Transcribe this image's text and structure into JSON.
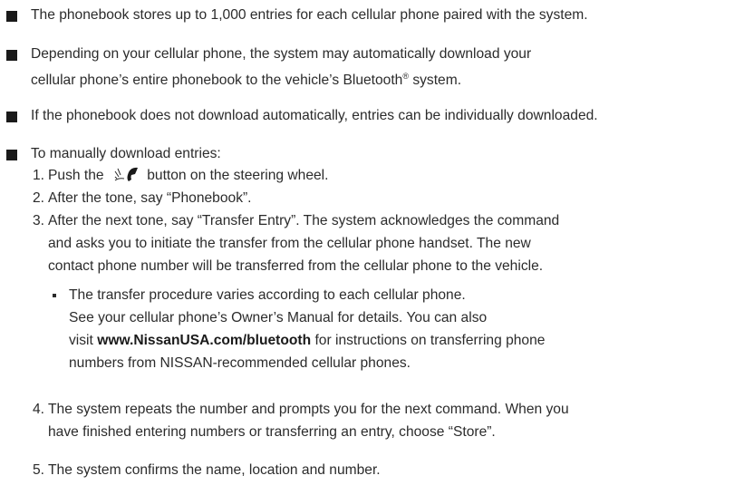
{
  "bullets": [
    {
      "lines": [
        "The phonebook stores up to 1,000 entries for each cellular phone paired with the system."
      ]
    },
    {
      "lines": [
        "Depending on your cellular phone, the system may automatically download your",
        "cellular phone’s entire phonebook to the vehicle’s Bluetooth"
      ],
      "line2_suffix": " system.",
      "trademark": "®"
    },
    {
      "lines": [
        "If the phonebook does not download automatically, entries can be individually downloaded."
      ]
    },
    {
      "lines": [
        "To manually download entries:"
      ]
    }
  ],
  "steps": [
    {
      "num": "1.",
      "before_icon": "Push the ",
      "icon": "voice-phone-icon",
      "after_icon": " button on the steering wheel."
    },
    {
      "num": "2.",
      "lines": [
        "After the tone, say “Phonebook”."
      ]
    },
    {
      "num": "3.",
      "lines": [
        "After the next tone, say “Transfer Entry”. The system acknowledges the command",
        "and asks you to initiate the transfer from the cellular phone handset. The new",
        "contact phone number will be transferred from the cellular phone to the vehicle."
      ]
    },
    {
      "num": "4.",
      "lines": [
        "The system repeats the number and prompts you for the next command. When you",
        "have finished entering numbers or transferring an entry, choose “Store”."
      ]
    },
    {
      "num": "5.",
      "lines": [
        "The system confirms the name, location and number."
      ]
    }
  ],
  "subbullet": {
    "lines": [
      "The transfer procedure varies according to each cellular phone.",
      "See your cellular phone’s Owner’s Manual for details. You can also"
    ],
    "line3_prefix": "visit ",
    "url": "www.NissanUSA.com/bluetooth",
    "line3_suffix": " for instructions on transferring phone",
    "line4": "numbers from NISSAN-recommended cellular phones."
  }
}
